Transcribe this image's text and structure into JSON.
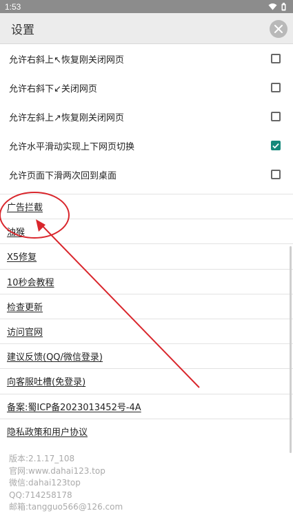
{
  "status_bar": {
    "time": "1:53",
    "icons": [
      "wifi-icon",
      "battery-icon"
    ]
  },
  "header": {
    "title": "设置",
    "close_icon": "close-icon"
  },
  "settings": [
    {
      "label": "允许右斜上↖恢复刚关闭网页",
      "checked": false
    },
    {
      "label": "允许右斜下↙关闭网页",
      "checked": false
    },
    {
      "label": "允许左斜上↗恢复刚关闭网页",
      "checked": false
    },
    {
      "label": "允许水平滑动实现上下网页切换",
      "checked": true
    },
    {
      "label": "允许页面下滑两次回到桌面",
      "checked": false
    }
  ],
  "links": [
    "广告拦截",
    "油猴",
    "X5修复",
    "10秒会教程",
    "检查更新",
    "访问官网",
    "建议反馈(QQ/微信登录)",
    "向客服吐槽(免登录)",
    "备案:蜀ICP备2023013452号-4A",
    "隐私政策和用户协议"
  ],
  "info": {
    "version": "版本:2.1.17_108",
    "website": "官网:www.dahai123.top",
    "wechat": "微信:dahai123top",
    "qq": "QQ:714258178",
    "email": "邮箱:tangguo566@126.com"
  },
  "colors": {
    "accent": "#16897b",
    "annotation": "#d9262c"
  }
}
